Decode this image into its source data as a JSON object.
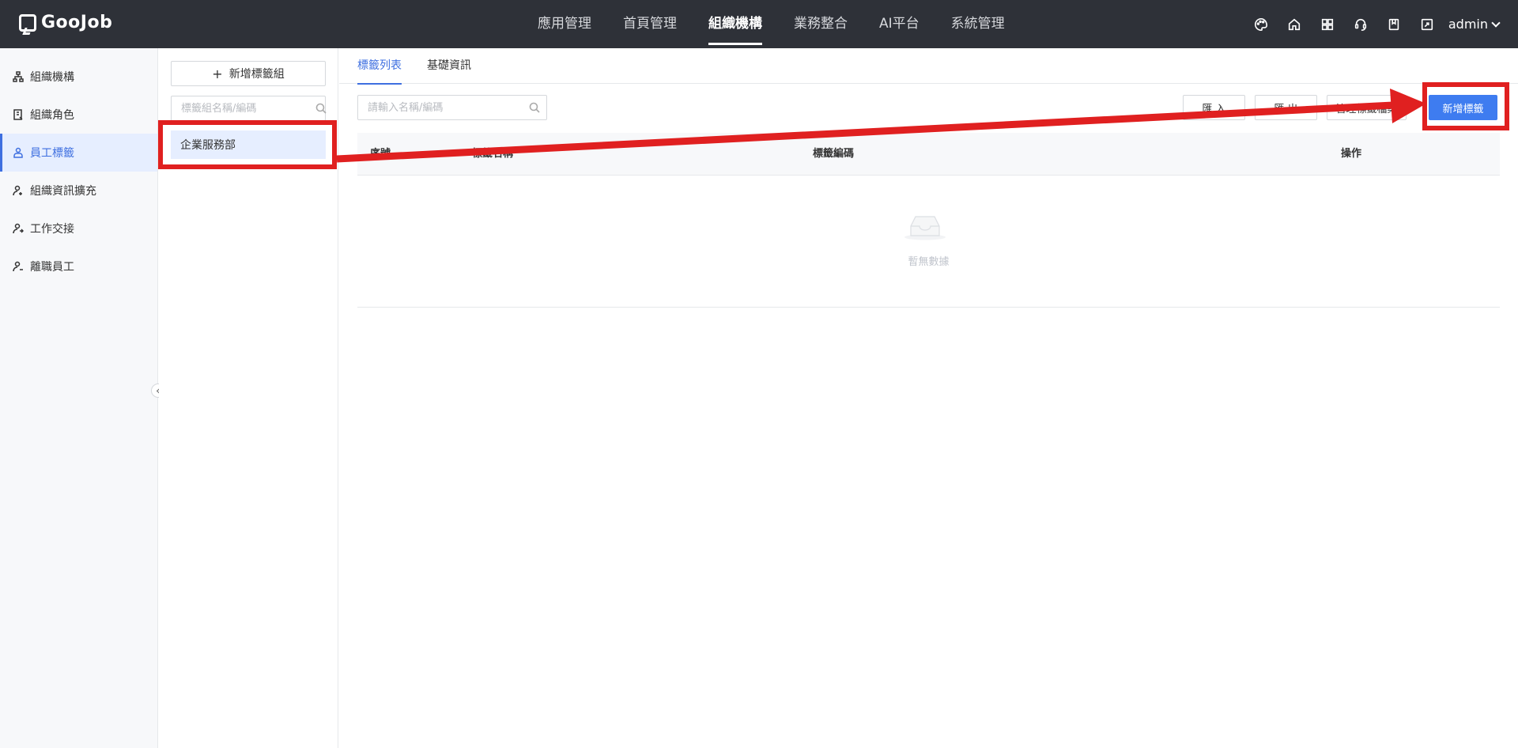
{
  "app": {
    "logo_text": "GooJob"
  },
  "topnav": {
    "items": [
      {
        "label": "應用管理"
      },
      {
        "label": "首頁管理"
      },
      {
        "label": "組織機構"
      },
      {
        "label": "業務整合"
      },
      {
        "label": "AI平台"
      },
      {
        "label": "系統管理"
      }
    ],
    "active": "組織機構"
  },
  "topbar": {
    "icons": [
      "palette-icon",
      "home-icon",
      "apps-grid-icon",
      "support-icon",
      "book-icon",
      "export-icon"
    ],
    "user": "admin"
  },
  "sidebar": {
    "items": [
      {
        "label": "組織機構",
        "icon": "org-tree-icon"
      },
      {
        "label": "組織角色",
        "icon": "role-badge-icon"
      },
      {
        "label": "員工標籤",
        "icon": "employee-tag-icon"
      },
      {
        "label": "組織資訊擴充",
        "icon": "user-extend-icon"
      },
      {
        "label": "工作交接",
        "icon": "user-handover-icon"
      },
      {
        "label": "離職員工",
        "icon": "user-resign-icon"
      }
    ],
    "active": "員工標籤"
  },
  "group_panel": {
    "add_button": "新增標籤組",
    "search_placeholder": "標籤組名稱/編碼",
    "groups": [
      {
        "label": "企業服務部"
      }
    ]
  },
  "main": {
    "tabs": [
      {
        "label": "標籤列表"
      },
      {
        "label": "基礎資訊"
      }
    ],
    "active_tab": "標籤列表",
    "search_placeholder": "請輸入名稱/編碼",
    "toolbar": {
      "import": "匯 入",
      "export": "匯 出",
      "manage": "管理標籤檔案",
      "add_tag": "新增標籤"
    },
    "table": {
      "columns": [
        "序號",
        "標籤名稱",
        "標籤編碼",
        "操作"
      ],
      "rows": [],
      "empty_text": "暫無數據"
    }
  },
  "colors": {
    "topbar": "#2e3138",
    "accent": "#3e6fe0",
    "primary_button": "#3e7cf0",
    "annotation": "#e02020"
  }
}
